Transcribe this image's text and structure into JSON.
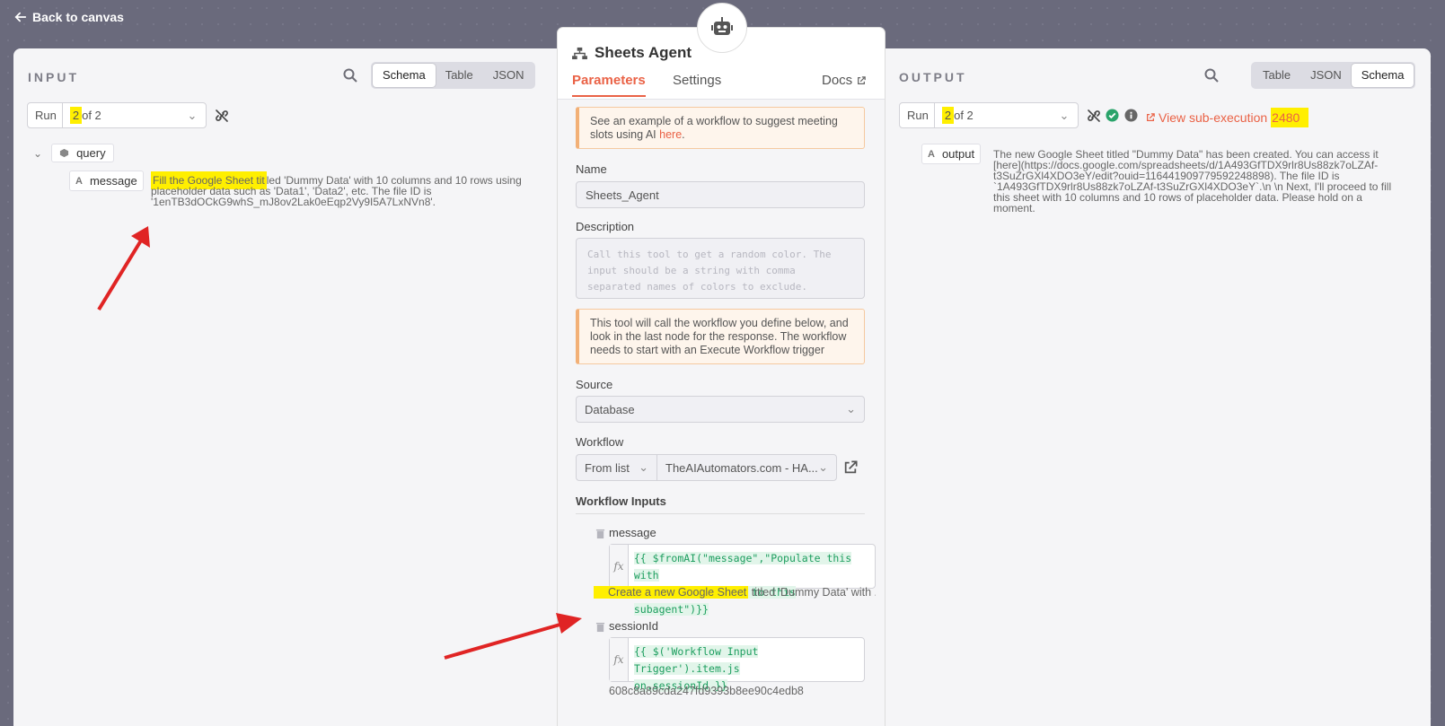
{
  "back": {
    "label": "Back to canvas"
  },
  "input_panel": {
    "label": "INPUT",
    "tabs": [
      "Schema",
      "Table",
      "JSON"
    ],
    "active_tab": "Schema",
    "run_label": "Run",
    "run_value_hl": "2",
    "run_value_rest": " of 2",
    "tree": {
      "root": "query",
      "field_name": "message",
      "field_type": "A",
      "value_hl": "Fill the Google Sheet tit",
      "value_rest_line1": "led 'Dummy Data' with 10 columns and 10 rows using",
      "value_line2": "placeholder data such as 'Data1', 'Data2', etc. The file ID is",
      "value_line3": "'1enTB3dOCkG9whS_mJ8ov2Lak0eEqp2Vy9I5A7LxNVn8'."
    }
  },
  "output_panel": {
    "label": "OUTPUT",
    "tabs": [
      "Table",
      "JSON",
      "Schema"
    ],
    "active_tab": "Schema",
    "run_label": "Run",
    "run_value_hl": "2",
    "run_value_rest": " of 2",
    "subexec_label": "View sub-execution",
    "subexec_number": "2480",
    "field_name": "output",
    "field_type": "A",
    "value_lines": [
      "The new Google Sheet titled \"Dummy Data\" has been created. You can access it",
      "[here](https://docs.google.com/spreadsheets/d/1A493GfTDX9rlr8Us88zk7oLZAf-",
      "t3SuZrGXl4XDO3eY/edit?ouid=116441909779592248898). The file ID is",
      "`1A493GfTDX9rlr8Us88zk7oLZAf-t3SuZrGXl4XDO3eY`.\\n \\n Next, I'll proceed to fill",
      "this sheet with 10 columns and 10 rows of placeholder data. Please hold on a",
      "moment."
    ]
  },
  "modal": {
    "title": "Sheets Agent",
    "tabs": {
      "parameters": "Parameters",
      "settings": "Settings",
      "docs": "Docs"
    },
    "notice1_text": "See an example of a workflow to suggest meeting slots using AI ",
    "notice1_link": "here",
    "notice1_end": ".",
    "name_label": "Name",
    "name_value": "Sheets_Agent",
    "description_label": "Description",
    "description_placeholder": "Call this tool to get a random color. The input should be a string with comma separated names of colors to exclude.",
    "notice2_text": "This tool will call the workflow you define below, and look in the last node for the response. The workflow needs to start with an Execute Workflow trigger",
    "source_label": "Source",
    "source_value": "Database",
    "workflow_label": "Workflow",
    "workflow_mode": "From list",
    "workflow_value": "TheAIAutomators.com - HA...",
    "workflow_inputs_title": "Workflow Inputs",
    "input1_name": "message",
    "input1_code_line1": "{{ $fromAI(\"message\",\"Populate this with",
    "input1_code_line2": "a relevant message to this subagent\")}}",
    "input1_preview_hl": "Create a new Google Sheet",
    "input1_preview_rest": " titled 'Dummy Data' with ...",
    "input2_name": "sessionId",
    "input2_code_line1": "{{ $('Workflow Input Trigger').item.js",
    "input2_code_line2": "on.sessionId }}",
    "input2_preview": "608c8a89cda247fd9393b8ee90c4edb8"
  },
  "colors": {
    "accent": "#ea6246",
    "highlight": "#ffef00",
    "arrow": "#e02424",
    "code_green": "#1d9e5f"
  }
}
